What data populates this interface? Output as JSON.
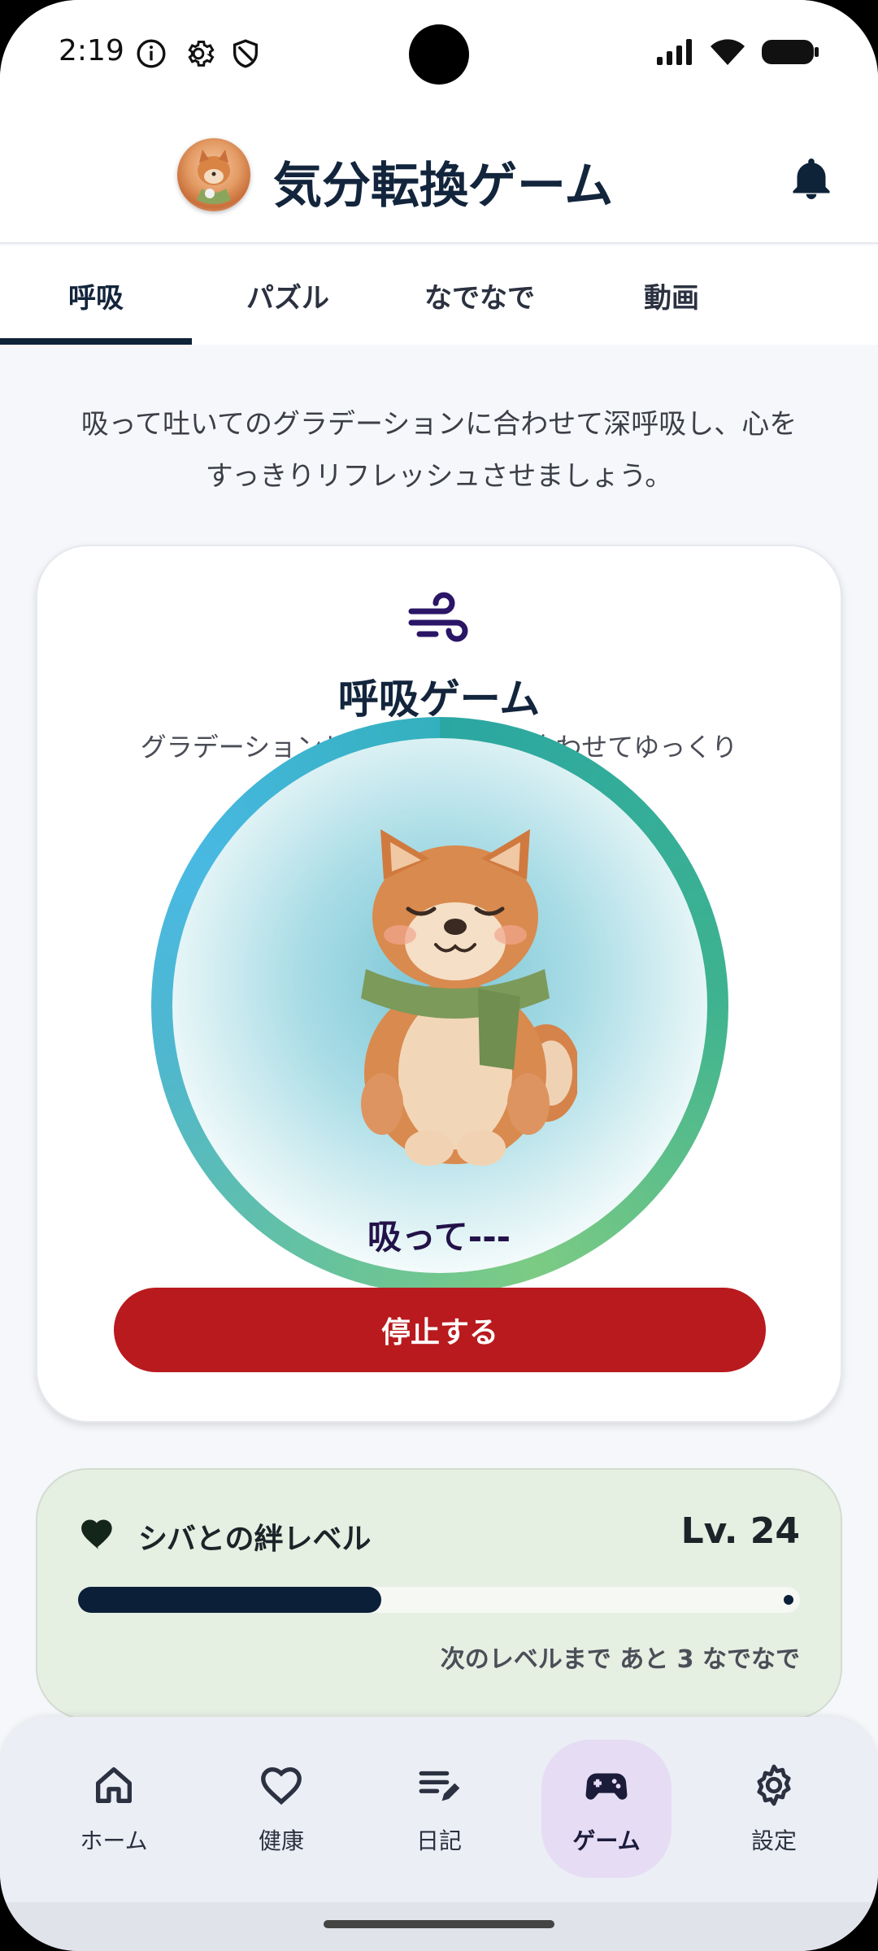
{
  "status_bar": {
    "time": "2:19"
  },
  "app_bar": {
    "title": "気分転換ゲーム"
  },
  "tabs": [
    {
      "label": "呼吸",
      "active": true
    },
    {
      "label": "パズル",
      "active": false
    },
    {
      "label": "なでなで",
      "active": false
    },
    {
      "label": "動画",
      "active": false
    }
  ],
  "intro_text": "吸って吐いてのグラデーションに合わせて深呼吸し、心をすっきりリフレッシュさせましょう。",
  "breathing_card": {
    "title": "呼吸ゲーム",
    "description": "グラデーションサークルの伸縮に合わせてゆっくりと深呼吸をしましょうワン",
    "phase_label": "吸って---",
    "stop_label": "停止する"
  },
  "bond": {
    "title": "シバとの絆レベル",
    "level": "Lv. 24",
    "progress": 0.42,
    "next_text": "次のレベルまで あと 3 なでなで"
  },
  "bottom_nav": [
    {
      "label": "ホーム",
      "icon": "home-icon",
      "active": false
    },
    {
      "label": "健康",
      "icon": "heart-icon",
      "active": false
    },
    {
      "label": "日記",
      "icon": "edit-note-icon",
      "active": false
    },
    {
      "label": "ゲーム",
      "icon": "gamepad-icon",
      "active": true
    },
    {
      "label": "設定",
      "icon": "gear-icon",
      "active": false
    }
  ],
  "colors": {
    "primary_dark": "#0e2238",
    "stop_button": "#b91a1e",
    "bond_card": "#e5efe2",
    "active_nav": "#e6dcf4"
  }
}
